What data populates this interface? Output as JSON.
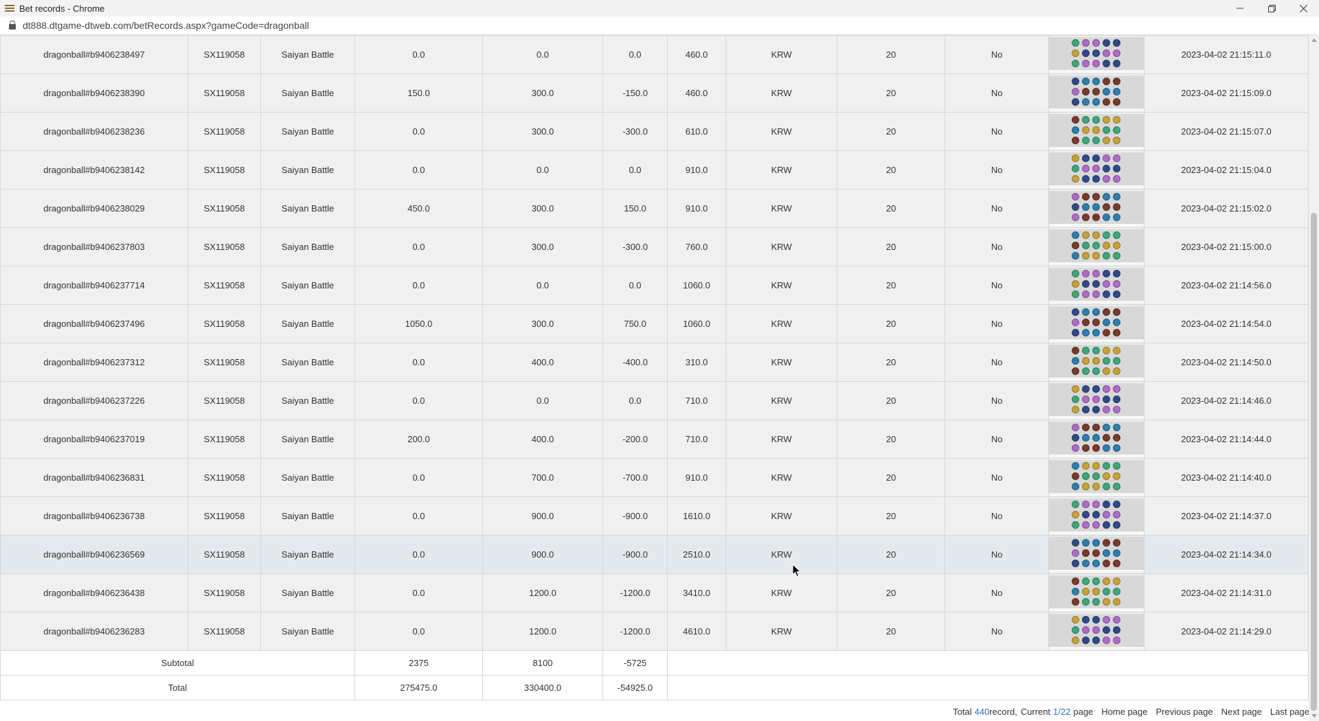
{
  "window": {
    "title": "Bet records - Chrome",
    "app_icon": "menu-lines-icon",
    "controls": [
      "minimize-icon",
      "restore-icon",
      "close-icon"
    ]
  },
  "address_bar": {
    "icon": "lock-icon",
    "url": "dt888.dtgame-dtweb.com/betRecords.aspx?gameCode=dragonball"
  },
  "table": {
    "rows": [
      {
        "id": "dragonball#b9406238497",
        "player": "SX119058",
        "game": "Saiyan Battle",
        "win": "0.0",
        "bet": "0.0",
        "profit": "0.0",
        "balance": "460.0",
        "currency": "KRW",
        "lines": "20",
        "free": "No",
        "time": "2023-04-02 21:15:11.0"
      },
      {
        "id": "dragonball#b9406238390",
        "player": "SX119058",
        "game": "Saiyan Battle",
        "win": "150.0",
        "bet": "300.0",
        "profit": "-150.0",
        "balance": "460.0",
        "currency": "KRW",
        "lines": "20",
        "free": "No",
        "time": "2023-04-02 21:15:09.0"
      },
      {
        "id": "dragonball#b9406238236",
        "player": "SX119058",
        "game": "Saiyan Battle",
        "win": "0.0",
        "bet": "300.0",
        "profit": "-300.0",
        "balance": "610.0",
        "currency": "KRW",
        "lines": "20",
        "free": "No",
        "time": "2023-04-02 21:15:07.0"
      },
      {
        "id": "dragonball#b9406238142",
        "player": "SX119058",
        "game": "Saiyan Battle",
        "win": "0.0",
        "bet": "0.0",
        "profit": "0.0",
        "balance": "910.0",
        "currency": "KRW",
        "lines": "20",
        "free": "No",
        "time": "2023-04-02 21:15:04.0"
      },
      {
        "id": "dragonball#b9406238029",
        "player": "SX119058",
        "game": "Saiyan Battle",
        "win": "450.0",
        "bet": "300.0",
        "profit": "150.0",
        "balance": "910.0",
        "currency": "KRW",
        "lines": "20",
        "free": "No",
        "time": "2023-04-02 21:15:02.0"
      },
      {
        "id": "dragonball#b9406237803",
        "player": "SX119058",
        "game": "Saiyan Battle",
        "win": "0.0",
        "bet": "300.0",
        "profit": "-300.0",
        "balance": "760.0",
        "currency": "KRW",
        "lines": "20",
        "free": "No",
        "time": "2023-04-02 21:15:00.0"
      },
      {
        "id": "dragonball#b9406237714",
        "player": "SX119058",
        "game": "Saiyan Battle",
        "win": "0.0",
        "bet": "0.0",
        "profit": "0.0",
        "balance": "1060.0",
        "currency": "KRW",
        "lines": "20",
        "free": "No",
        "time": "2023-04-02 21:14:56.0"
      },
      {
        "id": "dragonball#b9406237496",
        "player": "SX119058",
        "game": "Saiyan Battle",
        "win": "1050.0",
        "bet": "300.0",
        "profit": "750.0",
        "balance": "1060.0",
        "currency": "KRW",
        "lines": "20",
        "free": "No",
        "time": "2023-04-02 21:14:54.0"
      },
      {
        "id": "dragonball#b9406237312",
        "player": "SX119058",
        "game": "Saiyan Battle",
        "win": "0.0",
        "bet": "400.0",
        "profit": "-400.0",
        "balance": "310.0",
        "currency": "KRW",
        "lines": "20",
        "free": "No",
        "time": "2023-04-02 21:14:50.0"
      },
      {
        "id": "dragonball#b9406237226",
        "player": "SX119058",
        "game": "Saiyan Battle",
        "win": "0.0",
        "bet": "0.0",
        "profit": "0.0",
        "balance": "710.0",
        "currency": "KRW",
        "lines": "20",
        "free": "No",
        "time": "2023-04-02 21:14:46.0"
      },
      {
        "id": "dragonball#b9406237019",
        "player": "SX119058",
        "game": "Saiyan Battle",
        "win": "200.0",
        "bet": "400.0",
        "profit": "-200.0",
        "balance": "710.0",
        "currency": "KRW",
        "lines": "20",
        "free": "No",
        "time": "2023-04-02 21:14:44.0"
      },
      {
        "id": "dragonball#b9406236831",
        "player": "SX119058",
        "game": "Saiyan Battle",
        "win": "0.0",
        "bet": "700.0",
        "profit": "-700.0",
        "balance": "910.0",
        "currency": "KRW",
        "lines": "20",
        "free": "No",
        "time": "2023-04-02 21:14:40.0"
      },
      {
        "id": "dragonball#b9406236738",
        "player": "SX119058",
        "game": "Saiyan Battle",
        "win": "0.0",
        "bet": "900.0",
        "profit": "-900.0",
        "balance": "1610.0",
        "currency": "KRW",
        "lines": "20",
        "free": "No",
        "time": "2023-04-02 21:14:37.0"
      },
      {
        "id": "dragonball#b9406236569",
        "player": "SX119058",
        "game": "Saiyan Battle",
        "win": "0.0",
        "bet": "900.0",
        "profit": "-900.0",
        "balance": "2510.0",
        "currency": "KRW",
        "lines": "20",
        "free": "No",
        "time": "2023-04-02 21:14:34.0"
      },
      {
        "id": "dragonball#b9406236438",
        "player": "SX119058",
        "game": "Saiyan Battle",
        "win": "0.0",
        "bet": "1200.0",
        "profit": "-1200.0",
        "balance": "3410.0",
        "currency": "KRW",
        "lines": "20",
        "free": "No",
        "time": "2023-04-02 21:14:31.0"
      },
      {
        "id": "dragonball#b9406236283",
        "player": "SX119058",
        "game": "Saiyan Battle",
        "win": "0.0",
        "bet": "1200.0",
        "profit": "-1200.0",
        "balance": "4610.0",
        "currency": "KRW",
        "lines": "20",
        "free": "No",
        "time": "2023-04-02 21:14:29.0"
      }
    ],
    "subtotal": {
      "label": "Subtotal",
      "win": "2375",
      "bet": "8100",
      "profit": "-5725"
    },
    "total": {
      "label": "Total",
      "win": "275475.0",
      "bet": "330400.0",
      "profit": "-54925.0"
    }
  },
  "pager": {
    "total_prefix": "Total",
    "total_count": "440",
    "total_suffix": "record,",
    "current_prefix": "Current",
    "current_page": "1/22",
    "current_suffix": "page",
    "home": "Home page",
    "previous": "Previous page",
    "next": "Next page",
    "last": "Last page"
  },
  "colors": {
    "row_bg": "#f0f0f0",
    "hover_row_bg": "#e4e9ee",
    "border": "#cfd8dc",
    "link_accent": "#2f6fc0",
    "symbol_palette": [
      "#3aa87a",
      "#2f4a8a",
      "#7a3a2a",
      "#c9a233",
      "#b06ac9",
      "#2a7fb0"
    ]
  }
}
